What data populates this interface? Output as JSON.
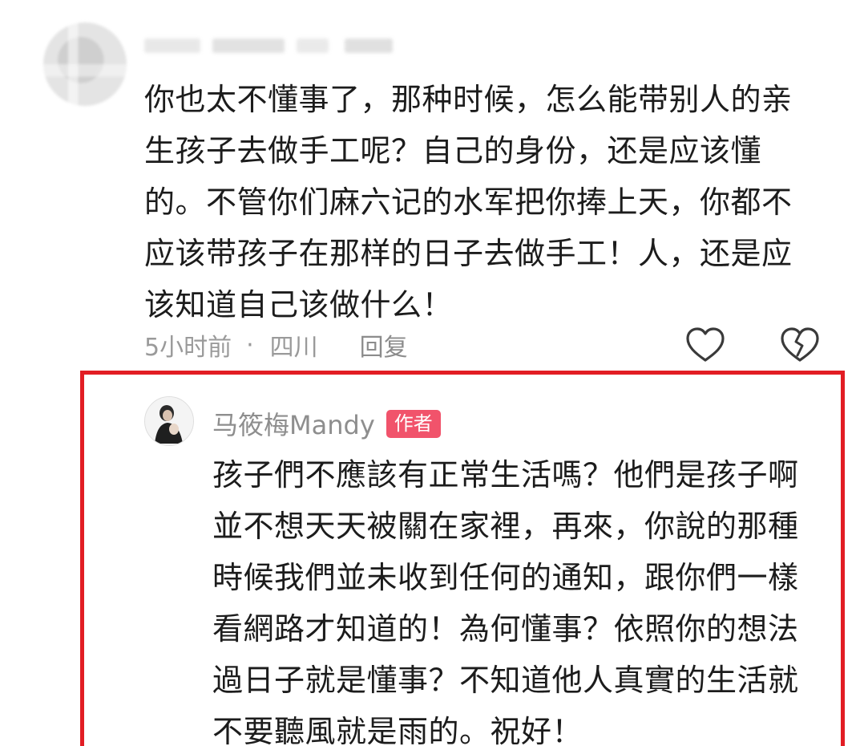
{
  "comment": {
    "lines": [
      "你也太不懂事了，那种时候，怎么能带别人的亲",
      "生孩子去做手工呢？自己的身份，还是应该懂",
      "的。不管你们麻六记的水军把你捧上天，你都不",
      "应该带孩子在那样的日子去做手工！人，还是应",
      "该知道自己该做什么！"
    ],
    "time": "5小时前",
    "separator": "·",
    "location": "四川",
    "reply_label": "回复",
    "like_icon": "heart-outline-icon",
    "dislike_icon": "broken-heart-icon"
  },
  "reply": {
    "name": "马筱梅Mandy",
    "badge": "作者",
    "lines": [
      "孩子們不應該有正常生活嗎？他們是孩子啊",
      "並不想天天被關在家裡，再來，你說的那種",
      "時候我們並未收到任何的通知，跟你們一樣",
      "看網路才知道的！為何懂事？依照你的想法",
      "過日子就是懂事？不知道他人真實的生活就",
      "不要聽風就是雨的。祝好！"
    ]
  },
  "colors": {
    "highlight_border": "#e21d24",
    "badge_bg": "#f1536b",
    "meta_text": "#9a9a9a"
  }
}
